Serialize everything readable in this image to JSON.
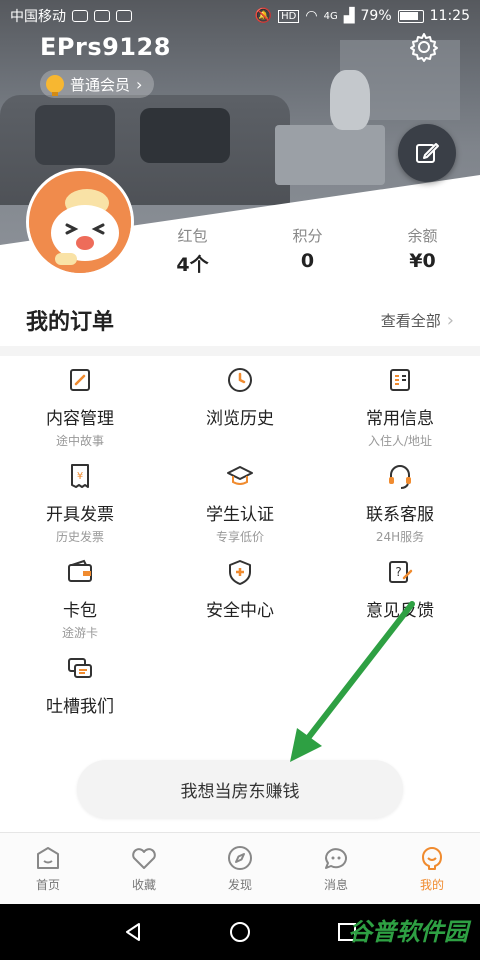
{
  "status_bar": {
    "carrier": "中国移动",
    "battery": "79%",
    "time": "11:25",
    "signal_label": "4G"
  },
  "profile": {
    "username": "EPrs9128",
    "member_level": "普通会员"
  },
  "stats": [
    {
      "label": "红包",
      "value": "4个"
    },
    {
      "label": "积分",
      "value": "0"
    },
    {
      "label": "余额",
      "value": "¥0"
    }
  ],
  "orders": {
    "title": "我的订单",
    "view_all": "查看全部"
  },
  "grid": [
    {
      "name": "内容管理",
      "sub": "途中故事",
      "icon": "edit-doc-icon"
    },
    {
      "name": "浏览历史",
      "sub": "",
      "icon": "clock-icon"
    },
    {
      "name": "常用信息",
      "sub": "入住人/地址",
      "icon": "list-doc-icon"
    },
    {
      "name": "开具发票",
      "sub": "历史发票",
      "icon": "invoice-icon"
    },
    {
      "name": "学生认证",
      "sub": "专享低价",
      "icon": "graduation-cap-icon"
    },
    {
      "name": "联系客服",
      "sub": "24H服务",
      "icon": "headset-icon"
    },
    {
      "name": "卡包",
      "sub": "途游卡",
      "icon": "wallet-icon"
    },
    {
      "name": "安全中心",
      "sub": "",
      "icon": "shield-icon"
    },
    {
      "name": "意见反馈",
      "sub": "",
      "icon": "feedback-icon"
    },
    {
      "name": "吐槽我们",
      "sub": "",
      "icon": "chat-icon"
    }
  ],
  "cta": {
    "label": "我想当房东赚钱"
  },
  "tabs": [
    {
      "label": "首页",
      "icon": "home-icon",
      "active": false
    },
    {
      "label": "收藏",
      "icon": "heart-icon",
      "active": false
    },
    {
      "label": "发现",
      "icon": "compass-icon",
      "active": false
    },
    {
      "label": "消息",
      "icon": "message-icon",
      "active": false
    },
    {
      "label": "我的",
      "icon": "profile-icon",
      "active": true
    }
  ],
  "watermark": "谷普软件园",
  "colors": {
    "accent": "#f08b2f",
    "annotation_arrow": "#2ea043",
    "fab": "#3a3f47"
  }
}
